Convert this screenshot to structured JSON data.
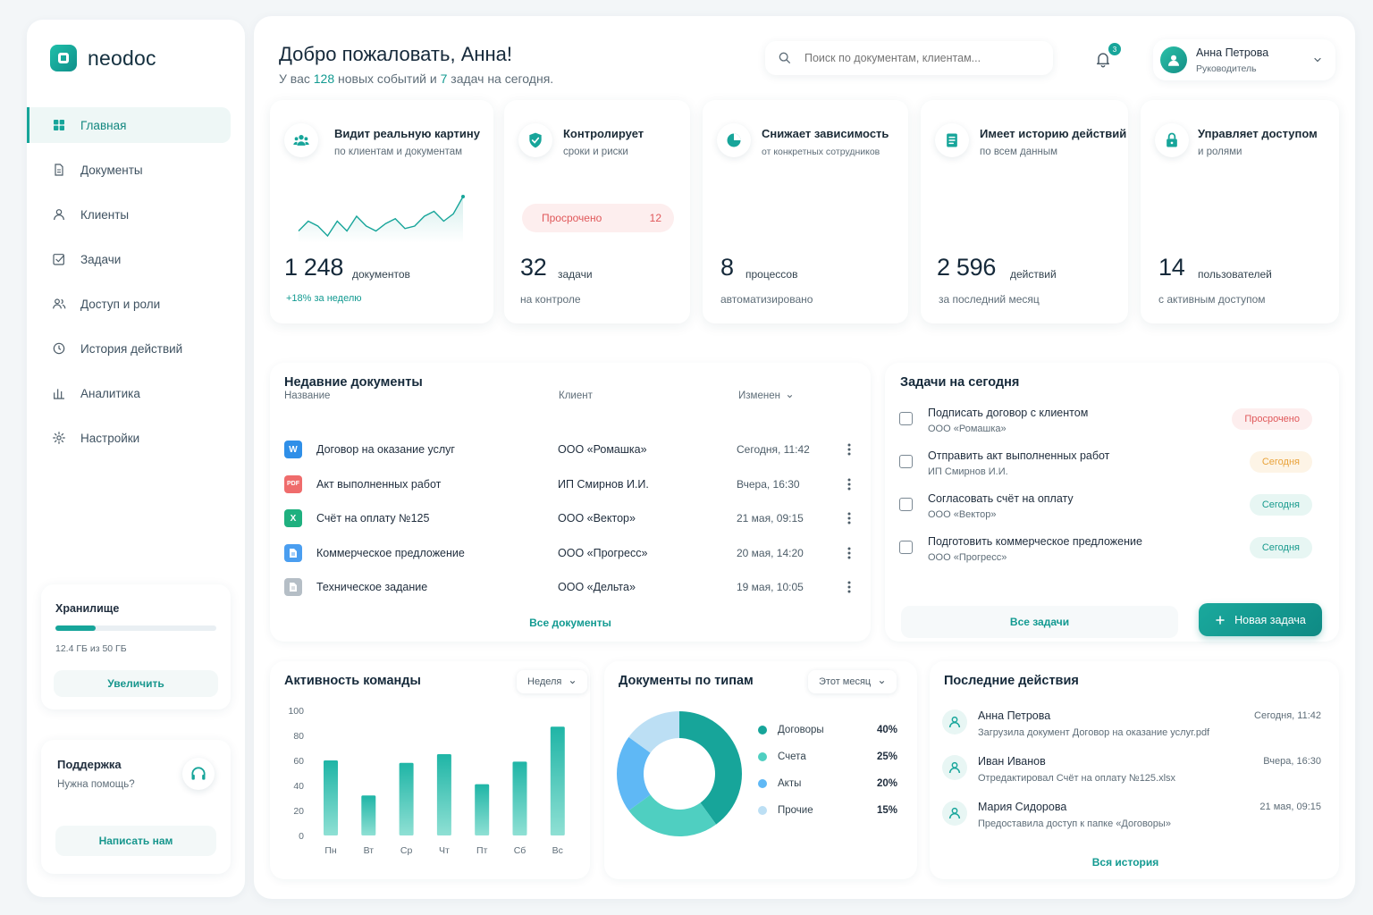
{
  "brand": {
    "name": "neodoc"
  },
  "sidebar": {
    "items": [
      {
        "label": "Главная",
        "icon": "grid-icon",
        "active": true
      },
      {
        "label": "Документы",
        "icon": "document-icon"
      },
      {
        "label": "Клиенты",
        "icon": "user-icon"
      },
      {
        "label": "Задачи",
        "icon": "task-check-icon"
      },
      {
        "label": "Доступ и роли",
        "icon": "users-icon"
      },
      {
        "label": "История действий",
        "icon": "history-clock-icon"
      },
      {
        "label": "Аналитика",
        "icon": "bar-chart-icon"
      },
      {
        "label": "Настройки",
        "icon": "gear-icon"
      }
    ],
    "storage": {
      "title": "Хранилище",
      "usage": "12.4 ГБ из 50 ГБ",
      "used_fraction": 0.248,
      "button": "Увеличить"
    },
    "support": {
      "title": "Поддержка",
      "subtitle": "Нужна помощь?",
      "button": "Написать нам"
    }
  },
  "header": {
    "greeting": "Добро пожаловать, Анна!",
    "sub_prefix": "У вас",
    "events_count": "128",
    "sub_mid": "новых событий и",
    "tasks_count": "7",
    "sub_suffix": "задач на сегодня.",
    "search_placeholder": "Поиск по документам, клиентам...",
    "notifications_count": "3",
    "user_name": "Анна Петрова",
    "user_role": "Руководитель"
  },
  "stats": [
    {
      "title": "Видит реальную картину",
      "subtitle": "по клиентам и документам",
      "value": "1 248",
      "unit": "документов",
      "note": "+18% за неделю",
      "icon": "team-icon"
    },
    {
      "title": "Контролирует",
      "subtitle": "сроки и риски",
      "value": "32",
      "unit": "задачи",
      "note": "на контроле",
      "icon": "shield-check-icon",
      "overdue_label": "Просрочено",
      "overdue_count": "12"
    },
    {
      "title": "Снижает зависимость",
      "subtitle": "от конкретных сотрудников",
      "value": "8",
      "unit": "процессов",
      "note": "автоматизировано",
      "icon": "pie-icon"
    },
    {
      "title": "Имеет историю действий",
      "subtitle": "по всем данным",
      "value": "2 596",
      "unit": "действий",
      "note": "за последний месяц",
      "icon": "list-doc-icon"
    },
    {
      "title": "Управляет доступом",
      "subtitle": "и ролями",
      "value": "14",
      "unit": "пользователей",
      "note": "с активным доступом",
      "icon": "lock-icon"
    }
  ],
  "recent_docs": {
    "title": "Недавние документы",
    "columns": [
      "Название",
      "Клиент",
      "Изменен"
    ],
    "rows": [
      {
        "type": "W",
        "color": "#2f8fe8",
        "name": "Договор на оказание услуг",
        "client": "ООО «Ромашка»",
        "modified": "Сегодня, 11:42"
      },
      {
        "type": "PDF",
        "color": "#ef6c6c",
        "name": "Акт выполненных работ",
        "client": "ИП Смирнов И.И.",
        "modified": "Вчера, 16:30"
      },
      {
        "type": "X",
        "color": "#1fb07f",
        "name": "Счёт на оплату №125",
        "client": "ООО «Вектор»",
        "modified": "21 мая, 09:15"
      },
      {
        "type": "doc",
        "color": "#4a9ef0",
        "name": "Коммерческое предложение",
        "client": "ООО «Прогресс»",
        "modified": "20 мая, 14:20"
      },
      {
        "type": "doc",
        "color": "#b5bec6",
        "name": "Техническое задание",
        "client": "ООО «Дельта»",
        "modified": "19 мая, 10:05"
      }
    ],
    "all_link": "Все документы"
  },
  "tasks_today": {
    "title": "Задачи на сегодня",
    "items": [
      {
        "title": "Подписать договор с клиентом",
        "client": "ООО «Ромашка»",
        "status": "Просрочено",
        "status_color": "#e0585a",
        "status_bg": "#fdeeee"
      },
      {
        "title": "Отправить акт выполненных работ",
        "client": "ИП Смирнов И.И.",
        "status": "Сегодня",
        "status_color": "#e9a23a",
        "status_bg": "#fdf4e6"
      },
      {
        "title": "Согласовать счёт на оплату",
        "client": "ООО «Вектор»",
        "status": "Сегодня",
        "status_color": "#179a8d",
        "status_bg": "#e7f6f3"
      },
      {
        "title": "Подготовить коммерческое предложение",
        "client": "ООО «Прогресс»",
        "status": "Сегодня",
        "status_color": "#179a8d",
        "status_bg": "#e7f6f3"
      }
    ],
    "all_link": "Все задачи",
    "new_button": "Новая задача"
  },
  "team_activity": {
    "title": "Активность команды",
    "period": "Неделя"
  },
  "doc_types": {
    "title": "Документы по типам",
    "period": "Этот месяц"
  },
  "recent_actions": {
    "title": "Последние действия",
    "items": [
      {
        "name": "Анна Петрова",
        "time": "Сегодня, 11:42",
        "desc": "Загрузила документ Договор на оказание услуг.pdf"
      },
      {
        "name": "Иван Иванов",
        "time": "Вчера, 16:30",
        "desc": "Отредактировал Счёт на оплату №125.xlsx"
      },
      {
        "name": "Мария Сидорова",
        "time": "21 мая, 09:15",
        "desc": "Предоставила доступ к папке «Договоры»"
      }
    ],
    "all_link": "Вся история"
  },
  "chart_data": [
    {
      "type": "bar",
      "title": "Активность команды",
      "categories": [
        "Пн",
        "Вт",
        "Ср",
        "Чт",
        "Пт",
        "Сб",
        "Вс"
      ],
      "values": [
        60,
        32,
        58,
        65,
        41,
        59,
        87
      ],
      "ylim": [
        0,
        100
      ],
      "yticks": [
        0,
        20,
        40,
        60,
        80,
        100
      ],
      "grid": false
    },
    {
      "type": "pie",
      "title": "Документы по типам",
      "labels": [
        "Договоры",
        "Счета",
        "Акты",
        "Прочие"
      ],
      "values": [
        40,
        25,
        20,
        15
      ],
      "value_labels": [
        "40%",
        "25%",
        "20%",
        "15%"
      ],
      "colors": [
        "#17a59a",
        "#4fcfc1",
        "#5fb8f5",
        "#bcdff4"
      ],
      "legend": "right"
    },
    {
      "type": "line",
      "title": "",
      "values": [
        12,
        16,
        14,
        10,
        16,
        12,
        18,
        14,
        12,
        15,
        17,
        13,
        14,
        18,
        20,
        16,
        19,
        26
      ],
      "note": "sparkline"
    }
  ]
}
